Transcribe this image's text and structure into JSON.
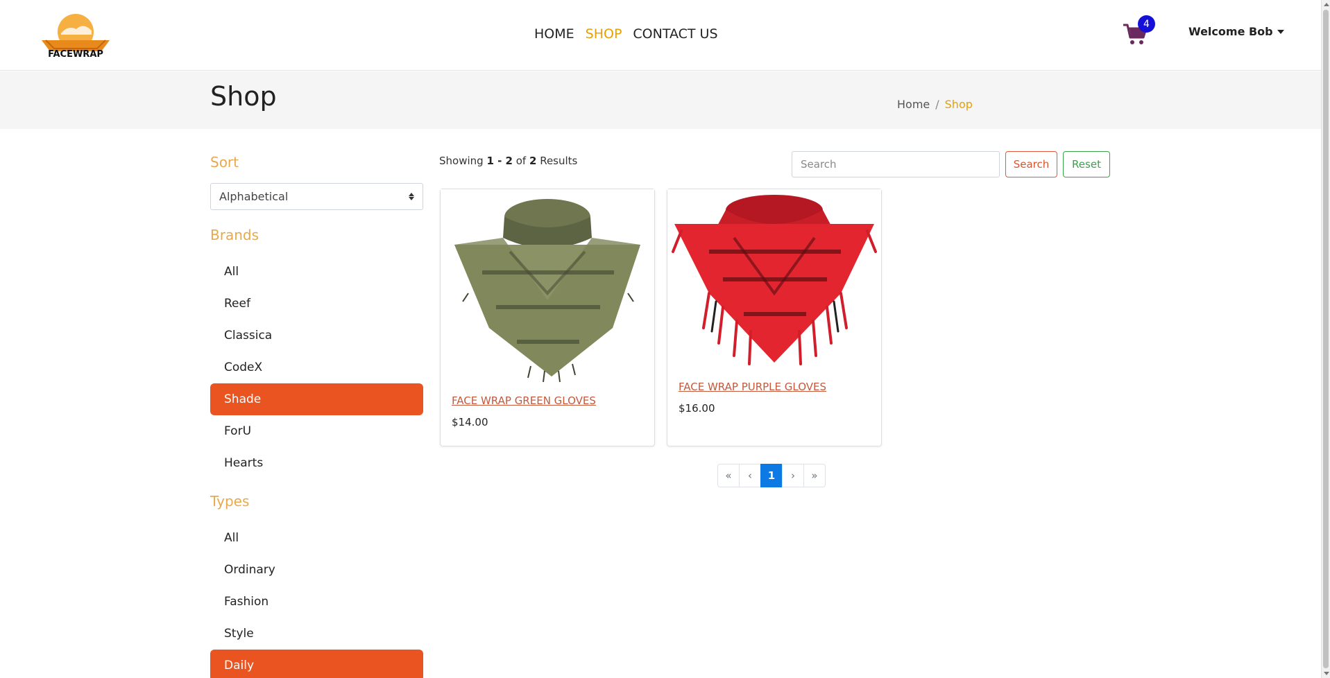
{
  "header": {
    "logo_text": "FACEWRAP",
    "nav": [
      {
        "label": "HOME",
        "active": false
      },
      {
        "label": "SHOP",
        "active": true
      },
      {
        "label": "CONTACT US",
        "active": false
      }
    ],
    "cart_count": "4",
    "user_menu": "Welcome Bob"
  },
  "banner": {
    "title": "Shop",
    "breadcrumb": [
      "Home",
      "Shop"
    ]
  },
  "sidebar": {
    "sort_heading": "Sort",
    "sort_value": "Alphabetical",
    "brands_heading": "Brands",
    "brands": [
      "All",
      "Reef",
      "Classica",
      "CodeX",
      "Shade",
      "ForU",
      "Hearts"
    ],
    "brands_active": "Shade",
    "types_heading": "Types",
    "types": [
      "All",
      "Ordinary",
      "Fashion",
      "Style",
      "Daily"
    ],
    "types_active": "Daily"
  },
  "results": {
    "prefix": "Showing ",
    "range": "1 - 2",
    "of": " of ",
    "total": "2",
    "suffix": " Results"
  },
  "search": {
    "placeholder": "Search",
    "search_label": "Search",
    "reset_label": "Reset"
  },
  "products": [
    {
      "name": "FACE WRAP GREEN GLOVES",
      "price": "$14.00",
      "color": "#7a8358"
    },
    {
      "name": "FACE WRAP PURPLE GLOVES",
      "price": "$16.00",
      "color": "#d8202a"
    }
  ],
  "pagination": {
    "first": "«",
    "prev": "‹",
    "current": "1",
    "next": "›",
    "last": "»"
  },
  "colors": {
    "accent": "#e95420",
    "brand_gold": "#e8a000",
    "link": "#c8583a",
    "badge": "#1410d8"
  }
}
